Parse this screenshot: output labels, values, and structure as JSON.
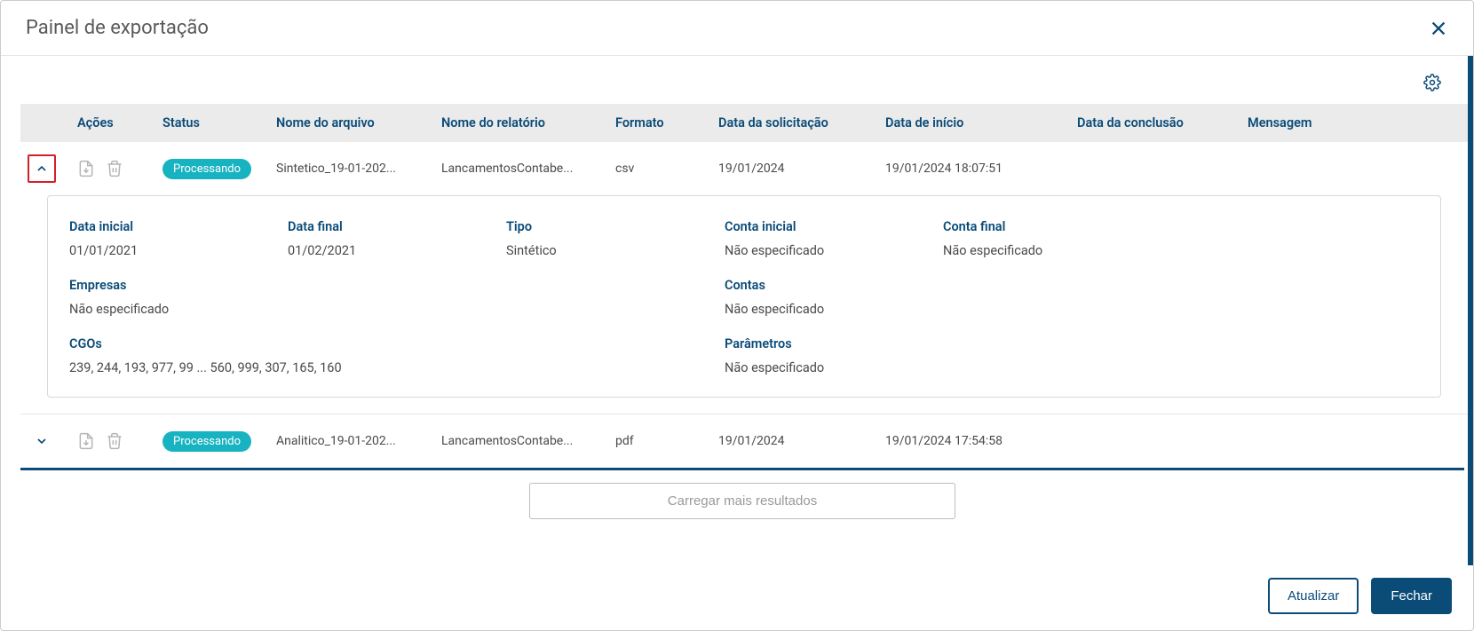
{
  "modal": {
    "title": "Painel de exportação"
  },
  "columns": {
    "acoes": "Ações",
    "status": "Status",
    "nome_arquivo": "Nome do arquivo",
    "nome_relatorio": "Nome do relatório",
    "formato": "Formato",
    "data_solicitacao": "Data da solicitação",
    "data_inicio": "Data de início",
    "data_conclusao": "Data da conclusão",
    "mensagem": "Mensagem"
  },
  "rows": [
    {
      "status": "Processando",
      "nome_arquivo": "Sintetico_19-01-202...",
      "nome_relatorio": "LancamentosContabe...",
      "formato": "csv",
      "data_solicitacao": "19/01/2024",
      "data_inicio": "19/01/2024 18:07:51",
      "data_conclusao": "",
      "mensagem": ""
    },
    {
      "status": "Processando",
      "nome_arquivo": "Analitico_19-01-202...",
      "nome_relatorio": "LancamentosContabe...",
      "formato": "pdf",
      "data_solicitacao": "19/01/2024",
      "data_inicio": "19/01/2024 17:54:58",
      "data_conclusao": "",
      "mensagem": ""
    }
  ],
  "details": {
    "labels": {
      "data_inicial": "Data inicial",
      "data_final": "Data final",
      "tipo": "Tipo",
      "conta_inicial": "Conta inicial",
      "conta_final": "Conta final",
      "empresas": "Empresas",
      "contas": "Contas",
      "cgos": "CGOs",
      "parametros": "Parâmetros"
    },
    "values": {
      "data_inicial": "01/01/2021",
      "data_final": "01/02/2021",
      "tipo": "Sintético",
      "conta_inicial": "Não especificado",
      "conta_final": "Não especificado",
      "empresas": "Não especificado",
      "contas": "Não especificado",
      "cgos": "239, 244, 193, 977, 99 ... 560, 999, 307, 165, 160",
      "parametros": "Não especificado"
    }
  },
  "buttons": {
    "load_more": "Carregar mais resultados",
    "atualizar": "Atualizar",
    "fechar": "Fechar"
  }
}
